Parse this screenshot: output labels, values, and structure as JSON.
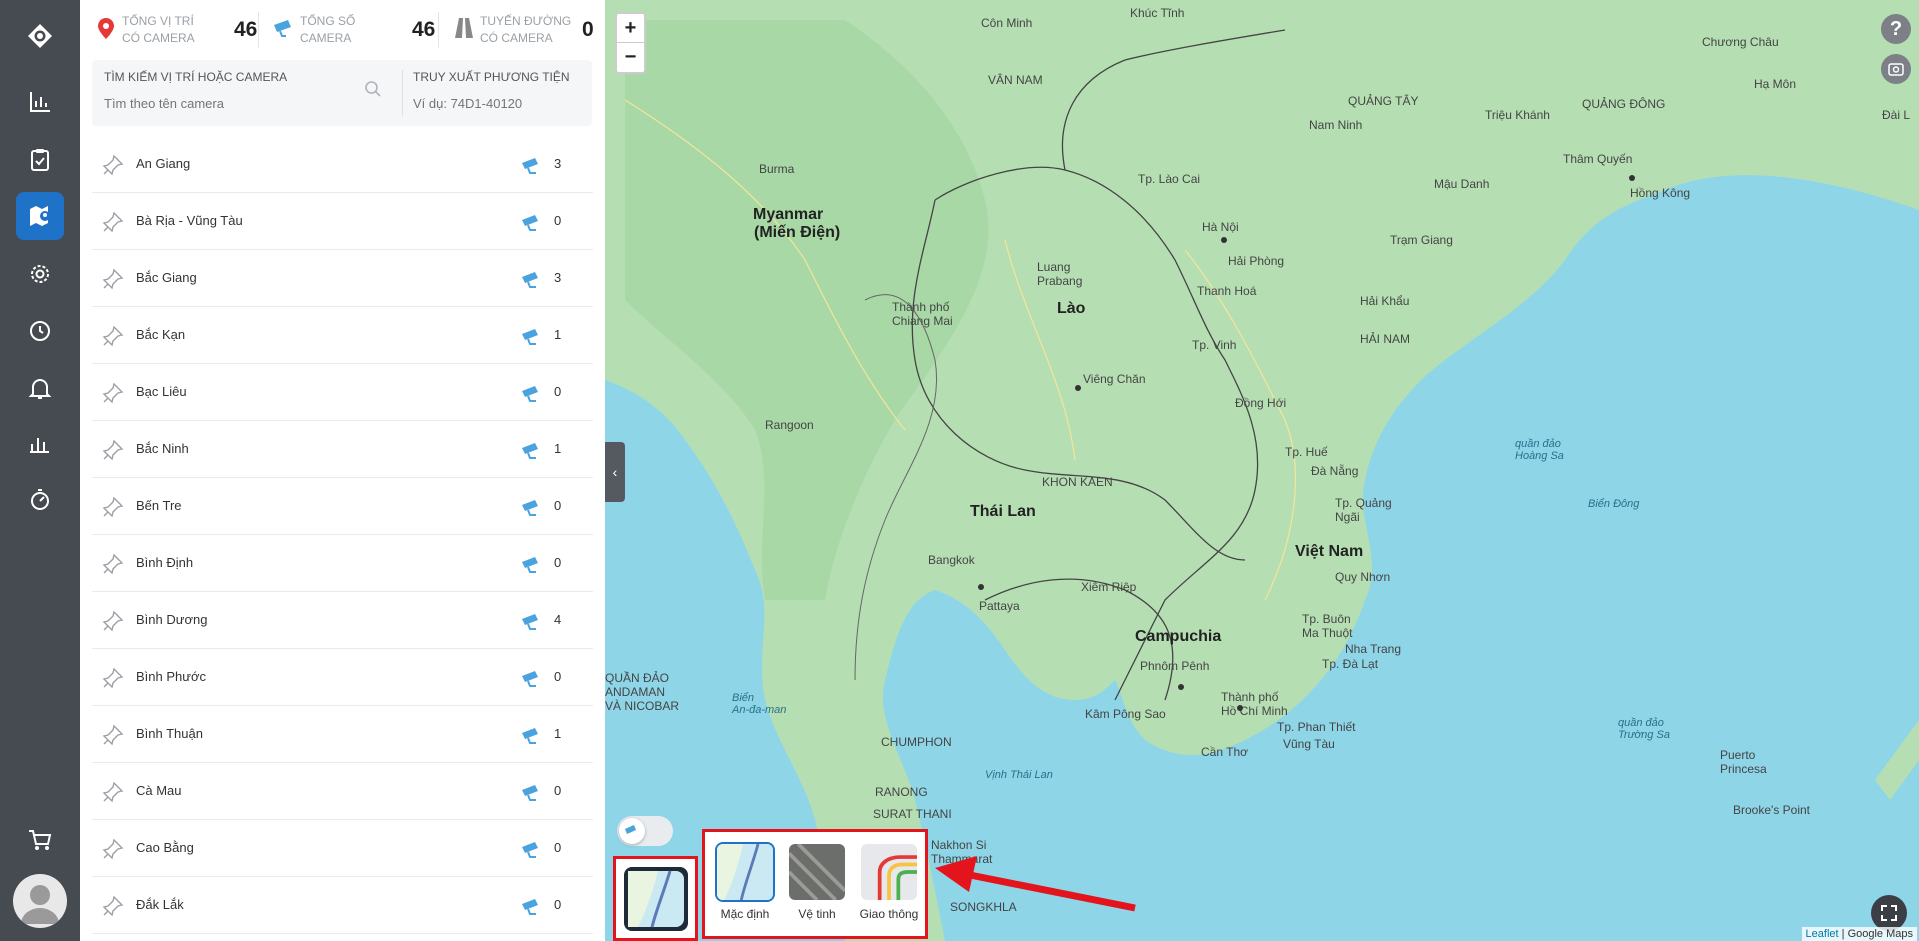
{
  "stats": {
    "locations": {
      "label_line1": "TỔNG VỊ TRÍ",
      "label_line2": "CÓ CAMERA",
      "value": "46"
    },
    "cameras": {
      "label_line1": "TỔNG SỐ",
      "label_line2": "CAMERA",
      "value": "46"
    },
    "routes": {
      "label_line1": "TUYẾN ĐƯỜNG",
      "label_line2": "CÓ CAMERA",
      "value": "0"
    }
  },
  "search": {
    "camera_title": "TÌM KIẾM VỊ TRÍ HOẶC CAMERA",
    "camera_placeholder": "Tìm theo tên camera",
    "vehicle_title": "TRUY XUẤT PHƯƠNG TIỆN",
    "vehicle_placeholder": "Ví dụ: 74D1-40120"
  },
  "provinces": [
    {
      "name": "An Giang",
      "count": "3"
    },
    {
      "name": "Bà Rịa - Vũng Tàu",
      "count": "0"
    },
    {
      "name": "Bắc Giang",
      "count": "3"
    },
    {
      "name": "Bắc Kạn",
      "count": "1"
    },
    {
      "name": "Bạc Liêu",
      "count": "0"
    },
    {
      "name": "Bắc Ninh",
      "count": "1"
    },
    {
      "name": "Bến Tre",
      "count": "0"
    },
    {
      "name": "Bình Định",
      "count": "0"
    },
    {
      "name": "Bình Dương",
      "count": "4"
    },
    {
      "name": "Bình Phước",
      "count": "0"
    },
    {
      "name": "Bình Thuận",
      "count": "1"
    },
    {
      "name": "Cà Mau",
      "count": "0"
    },
    {
      "name": "Cao Bằng",
      "count": "0"
    },
    {
      "name": "Đắk Lắk",
      "count": "0"
    }
  ],
  "map": {
    "zoom_in": "+",
    "zoom_out": "−",
    "help": "?",
    "layers": [
      {
        "label": "Mặc định",
        "selected": true
      },
      {
        "label": "Vệ tinh",
        "selected": false
      },
      {
        "label": "Giao thông",
        "selected": false
      }
    ],
    "attribution_leaflet": "Leaflet",
    "attribution_sep": " | ",
    "attribution_google": "Google Maps",
    "labels": {
      "myanmar": "Myanmar",
      "myanmar2": "(Miến Điện)",
      "lao": "Lào",
      "thailand": "Thái Lan",
      "vietnam": "Việt Nam",
      "cambodia": "Campuchia",
      "hainan": "HẢI NAM",
      "hanoi": "Hà Nội",
      "haiphong": "Hải Phòng",
      "bangkok": "Bangkok",
      "phnompenh": "Phnôm Pênh",
      "hcm": "Thành phố\nHồ Chí Minh",
      "vientiane": "Viêng Chăn",
      "nanning": "Nam Ninh",
      "hongkong": "Hồng Kông",
      "kunming": "Côn Minh",
      "bien_dong": "Biển Đông",
      "vinh_thai_lan": "Vịnh Thái Lan",
      "vannam": "VÂN NAM",
      "quangtay": "QUẢNG TÂY",
      "quangdong": "QUẢNG ĐÔNG",
      "burma": "Burma",
      "haikhau": "Hải Khẩu",
      "tramgiang": "Trạm Giang",
      "hoangsa": "quần đảo\nHoàng Sa",
      "truongsa": "quần đảo\nTrường Sa",
      "danang": "Đà Nẵng",
      "hue": "Tp. Huế",
      "vinh": "Tp. Vinh",
      "thanhhoa": "Thanh Hoá",
      "cantho": "Cần Thơ",
      "vungtau": "Vũng Tàu",
      "nhatrang": "Nha Trang",
      "dalat": "Tp. Đà Lạt",
      "quynhon": "Quy Nhơn",
      "buonmathuot": "Tp. Buôn\nMa Thuột",
      "siemreap": "Xiêm Riệp",
      "pattaya": "Pattaya",
      "chiangmai": "Thành phố\nChiang Mai",
      "yangon": "Rangoon",
      "bienandaman": "Biển\nAn-đa-man",
      "andaman": "QUẦN ĐẢO\nANDAMAN\nVÀ NICOBAR",
      "chumphon": "CHUMPHON",
      "ranong": "RANONG",
      "suratthani": "SURAT THANI",
      "songkhla": "SONGKHLA",
      "nakhon": "Nakhon Si\nThammarat",
      "khonkaen": "KHON KAEN",
      "laocai": "Tp. Lào Cai",
      "luangprabang": "Luang\nPrabang",
      "khuctinh": "Khúc Tĩnh",
      "chuongchau": "Chương Châu",
      "trieukhanh": "Triệu Khánh",
      "thamquyen": "Thâm Quyến",
      "mauzdanh": "Mậu Danh",
      "haimon": "Hạ Môn",
      "daili": "Đài L",
      "puerto": "Puerto\nPrincesa",
      "brookes": "Brooke's Point",
      "rachgia": "Kâm Pông Sao",
      "phanthiet": "Tp. Phan Thiết",
      "donghoi": "Đồng Hới",
      "quangngai": "Tp. Quảng\nNgãi"
    }
  }
}
